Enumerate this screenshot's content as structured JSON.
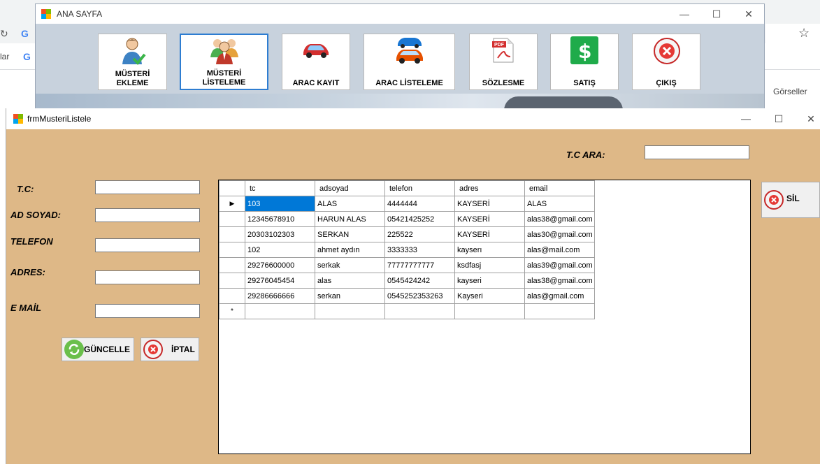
{
  "browser": {
    "google_letter": "G",
    "side_text": "lar",
    "right_link": "Görseller",
    "star": "☆"
  },
  "main_window": {
    "title": "ANA SAYFA",
    "controls": {
      "minimize": "—",
      "maximize": "☐",
      "close": "✕"
    },
    "toolbar": [
      {
        "line1": "MÜSTERİ",
        "line2": "EKLEME",
        "icon": "customer-add-icon"
      },
      {
        "line1": "MÜSTERİ",
        "line2": "LİSTELEME",
        "icon": "customers-list-icon"
      },
      {
        "line1": "ARAC KAYIT",
        "line2": "",
        "icon": "car-icon"
      },
      {
        "line1": "ARAC LİSTELEME",
        "line2": "",
        "icon": "cars-list-icon"
      },
      {
        "line1": "SÖZLESME",
        "line2": "",
        "icon": "pdf-icon"
      },
      {
        "line1": "SATIŞ",
        "line2": "",
        "icon": "dollar-icon"
      },
      {
        "line1": "ÇIKIŞ",
        "line2": "",
        "icon": "exit-icon"
      }
    ]
  },
  "list_window": {
    "title": "frmMusteriListele",
    "controls": {
      "minimize": "—",
      "maximize": "☐",
      "close": "✕"
    },
    "search_label": "T.C ARA:",
    "search_value": "",
    "form": {
      "tc_label": "T.C:",
      "adsoyad_label": "AD SOYAD:",
      "telefon_label": "TELEFON",
      "adres_label": "ADRES:",
      "email_label": "E MAİL"
    },
    "buttons": {
      "update": "GÜNCELLE",
      "cancel": "İPTAL",
      "delete": "SİL"
    },
    "grid": {
      "columns": [
        "tc",
        "adsoyad",
        "telefon",
        "adres",
        "email"
      ],
      "rows": [
        [
          "103",
          "ALAS",
          "4444444",
          "KAYSERİ",
          "ALAS"
        ],
        [
          "12345678910",
          "HARUN ALAS",
          "05421425252",
          "KAYSERİ",
          "alas38@gmail.com"
        ],
        [
          "20303102303",
          "SERKAN",
          "225522",
          "KAYSERİ",
          "alas30@gmail.com"
        ],
        [
          "102",
          "ahmet aydın",
          "3333333",
          "kayserı",
          "alas@mail.com"
        ],
        [
          "29276600000",
          "serkak",
          "77777777777",
          "ksdfasj",
          "alas39@gmail.com"
        ],
        [
          "29276045454",
          "alas",
          "0545424242",
          "kayseri",
          "alas38@gmail.com"
        ],
        [
          "29286666666",
          "serkan",
          "0545252353263",
          "Kayseri",
          "alas@gmail.com"
        ]
      ],
      "current_row_marker": "▶",
      "new_row_marker": "*"
    }
  }
}
